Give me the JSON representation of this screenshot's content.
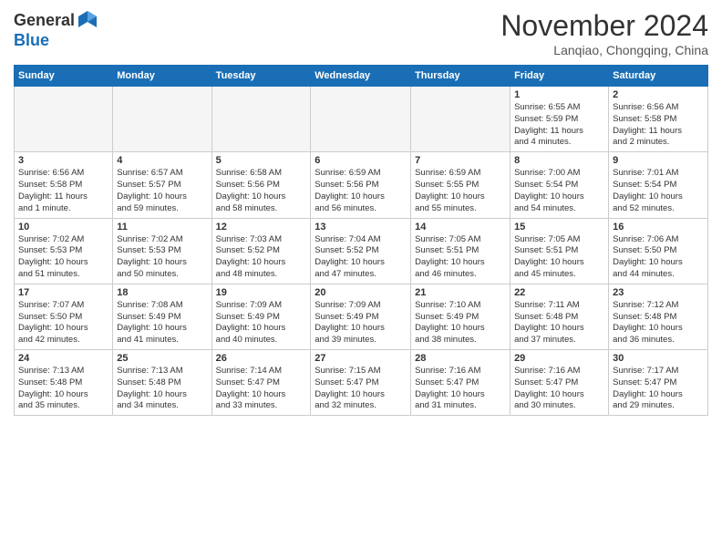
{
  "header": {
    "logo_general": "General",
    "logo_blue": "Blue",
    "month_title": "November 2024",
    "location": "Lanqiao, Chongqing, China"
  },
  "weekdays": [
    "Sunday",
    "Monday",
    "Tuesday",
    "Wednesday",
    "Thursday",
    "Friday",
    "Saturday"
  ],
  "weeks": [
    [
      {
        "day": "",
        "info": ""
      },
      {
        "day": "",
        "info": ""
      },
      {
        "day": "",
        "info": ""
      },
      {
        "day": "",
        "info": ""
      },
      {
        "day": "",
        "info": ""
      },
      {
        "day": "1",
        "info": "Sunrise: 6:55 AM\nSunset: 5:59 PM\nDaylight: 11 hours\nand 4 minutes."
      },
      {
        "day": "2",
        "info": "Sunrise: 6:56 AM\nSunset: 5:58 PM\nDaylight: 11 hours\nand 2 minutes."
      }
    ],
    [
      {
        "day": "3",
        "info": "Sunrise: 6:56 AM\nSunset: 5:58 PM\nDaylight: 11 hours\nand 1 minute."
      },
      {
        "day": "4",
        "info": "Sunrise: 6:57 AM\nSunset: 5:57 PM\nDaylight: 10 hours\nand 59 minutes."
      },
      {
        "day": "5",
        "info": "Sunrise: 6:58 AM\nSunset: 5:56 PM\nDaylight: 10 hours\nand 58 minutes."
      },
      {
        "day": "6",
        "info": "Sunrise: 6:59 AM\nSunset: 5:56 PM\nDaylight: 10 hours\nand 56 minutes."
      },
      {
        "day": "7",
        "info": "Sunrise: 6:59 AM\nSunset: 5:55 PM\nDaylight: 10 hours\nand 55 minutes."
      },
      {
        "day": "8",
        "info": "Sunrise: 7:00 AM\nSunset: 5:54 PM\nDaylight: 10 hours\nand 54 minutes."
      },
      {
        "day": "9",
        "info": "Sunrise: 7:01 AM\nSunset: 5:54 PM\nDaylight: 10 hours\nand 52 minutes."
      }
    ],
    [
      {
        "day": "10",
        "info": "Sunrise: 7:02 AM\nSunset: 5:53 PM\nDaylight: 10 hours\nand 51 minutes."
      },
      {
        "day": "11",
        "info": "Sunrise: 7:02 AM\nSunset: 5:53 PM\nDaylight: 10 hours\nand 50 minutes."
      },
      {
        "day": "12",
        "info": "Sunrise: 7:03 AM\nSunset: 5:52 PM\nDaylight: 10 hours\nand 48 minutes."
      },
      {
        "day": "13",
        "info": "Sunrise: 7:04 AM\nSunset: 5:52 PM\nDaylight: 10 hours\nand 47 minutes."
      },
      {
        "day": "14",
        "info": "Sunrise: 7:05 AM\nSunset: 5:51 PM\nDaylight: 10 hours\nand 46 minutes."
      },
      {
        "day": "15",
        "info": "Sunrise: 7:05 AM\nSunset: 5:51 PM\nDaylight: 10 hours\nand 45 minutes."
      },
      {
        "day": "16",
        "info": "Sunrise: 7:06 AM\nSunset: 5:50 PM\nDaylight: 10 hours\nand 44 minutes."
      }
    ],
    [
      {
        "day": "17",
        "info": "Sunrise: 7:07 AM\nSunset: 5:50 PM\nDaylight: 10 hours\nand 42 minutes."
      },
      {
        "day": "18",
        "info": "Sunrise: 7:08 AM\nSunset: 5:49 PM\nDaylight: 10 hours\nand 41 minutes."
      },
      {
        "day": "19",
        "info": "Sunrise: 7:09 AM\nSunset: 5:49 PM\nDaylight: 10 hours\nand 40 minutes."
      },
      {
        "day": "20",
        "info": "Sunrise: 7:09 AM\nSunset: 5:49 PM\nDaylight: 10 hours\nand 39 minutes."
      },
      {
        "day": "21",
        "info": "Sunrise: 7:10 AM\nSunset: 5:49 PM\nDaylight: 10 hours\nand 38 minutes."
      },
      {
        "day": "22",
        "info": "Sunrise: 7:11 AM\nSunset: 5:48 PM\nDaylight: 10 hours\nand 37 minutes."
      },
      {
        "day": "23",
        "info": "Sunrise: 7:12 AM\nSunset: 5:48 PM\nDaylight: 10 hours\nand 36 minutes."
      }
    ],
    [
      {
        "day": "24",
        "info": "Sunrise: 7:13 AM\nSunset: 5:48 PM\nDaylight: 10 hours\nand 35 minutes."
      },
      {
        "day": "25",
        "info": "Sunrise: 7:13 AM\nSunset: 5:48 PM\nDaylight: 10 hours\nand 34 minutes."
      },
      {
        "day": "26",
        "info": "Sunrise: 7:14 AM\nSunset: 5:47 PM\nDaylight: 10 hours\nand 33 minutes."
      },
      {
        "day": "27",
        "info": "Sunrise: 7:15 AM\nSunset: 5:47 PM\nDaylight: 10 hours\nand 32 minutes."
      },
      {
        "day": "28",
        "info": "Sunrise: 7:16 AM\nSunset: 5:47 PM\nDaylight: 10 hours\nand 31 minutes."
      },
      {
        "day": "29",
        "info": "Sunrise: 7:16 AM\nSunset: 5:47 PM\nDaylight: 10 hours\nand 30 minutes."
      },
      {
        "day": "30",
        "info": "Sunrise: 7:17 AM\nSunset: 5:47 PM\nDaylight: 10 hours\nand 29 minutes."
      }
    ]
  ]
}
